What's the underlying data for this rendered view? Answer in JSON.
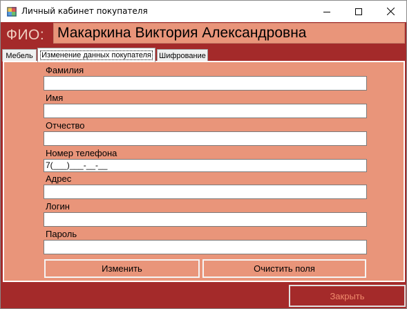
{
  "window": {
    "title": "Личный кабинет покупателя"
  },
  "header": {
    "fio_label": "ФИО:",
    "fio_value": "Макаркина Виктория Александровна"
  },
  "tabs": [
    {
      "label": "Мебель",
      "active": false
    },
    {
      "label": "Изменение данных покупателя",
      "active": true
    },
    {
      "label": "Шифрование",
      "active": false
    }
  ],
  "form": {
    "fields": [
      {
        "label": "Фамилия",
        "value": ""
      },
      {
        "label": "Имя",
        "value": ""
      },
      {
        "label": "Отчество",
        "value": ""
      },
      {
        "label": "Номер телефона",
        "value": "7(___)___-__-__"
      },
      {
        "label": "Адрес",
        "value": ""
      },
      {
        "label": "Логин",
        "value": ""
      },
      {
        "label": "Пароль",
        "value": ""
      }
    ],
    "change_button": "Изменить",
    "clear_button": "Очистить поля"
  },
  "footer": {
    "close_button": "Закрыть"
  },
  "colors": {
    "primary_dark": "#a42a2a",
    "primary_light": "#e9957a",
    "accent_text": "#f08a6c"
  }
}
